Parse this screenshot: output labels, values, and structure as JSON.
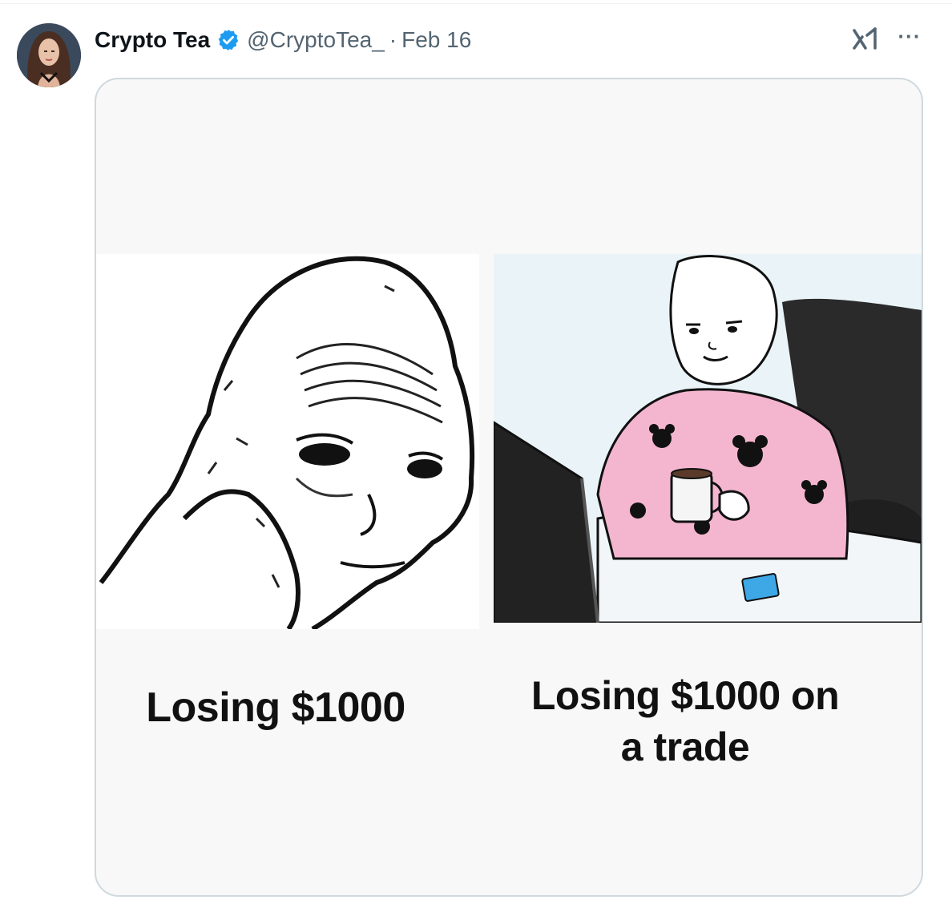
{
  "tweet": {
    "author_name": "Crypto Tea",
    "handle": "@CryptoTea_",
    "separator": "·",
    "date": "Feb 16",
    "more_label": "···"
  },
  "media": {
    "left_caption": "Losing $1000",
    "right_caption_line1": "Losing $1000 on",
    "right_caption_line2": "a trade"
  },
  "icons": {
    "verified": "verified-badge-icon",
    "grok": "grok-icon",
    "more": "more-icon"
  },
  "colors": {
    "verified_blue": "#1d9bf0",
    "secondary_text": "#536471",
    "border": "#cfd9de",
    "pajama_pink": "#f4b6cf"
  }
}
